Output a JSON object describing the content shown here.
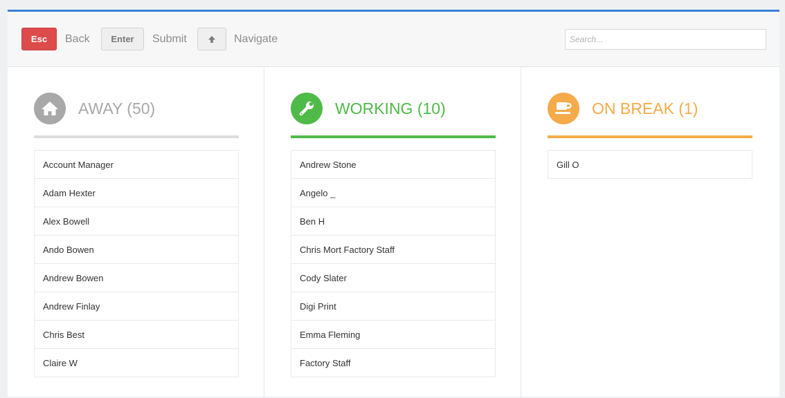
{
  "toolbar": {
    "esc_key": "Esc",
    "back_label": "Back",
    "enter_key": "Enter",
    "submit_label": "Submit",
    "up_key_icon": "arrow-up-icon",
    "navigate_label": "Navigate",
    "search_placeholder": "Search...",
    "search_value": ""
  },
  "colors": {
    "accent_bar": "#3a7fd5",
    "esc_red": "#dd4b4b",
    "away": "#a8a8a8",
    "working": "#4fba48",
    "on_break": "#f5ab4a"
  },
  "columns": [
    {
      "icon": "home-icon",
      "title": "AWAY (50)",
      "items": [
        "Account Manager",
        "Adam Hexter",
        "Alex Bowell",
        "Ando Bowen",
        "Andrew Bowen",
        "Andrew Finlay",
        "Chris Best",
        "Claire W"
      ]
    },
    {
      "icon": "wrench-icon",
      "title": "WORKING (10)",
      "items": [
        "Andrew Stone",
        "Angelo _",
        "Ben H",
        "Chris Mort Factory Staff",
        "Cody Slater",
        "Digi Print",
        "Emma Fleming",
        "Factory Staff"
      ]
    },
    {
      "icon": "coffee-icon",
      "title": "ON BREAK (1)",
      "items": [
        "Gill O"
      ]
    }
  ]
}
